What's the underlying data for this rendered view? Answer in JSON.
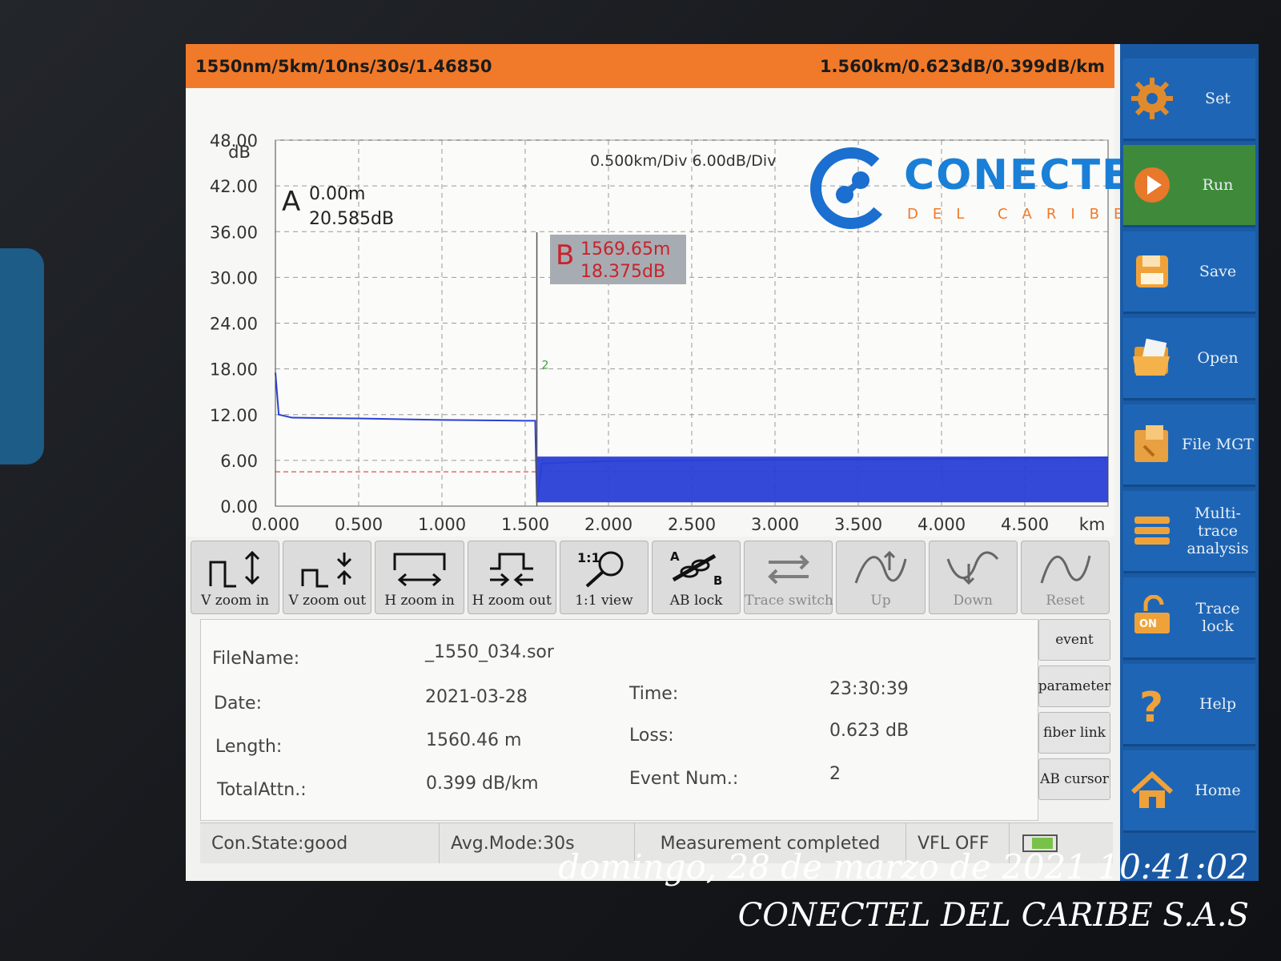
{
  "header": {
    "left": "1550nm/5km/10ns/30s/1.46850",
    "right": "1.560km/0.623dB/0.399dB/km"
  },
  "plot": {
    "scale": "0.500km/Div  6.00dB/Div",
    "y_unit": "dB",
    "x_unit": "km",
    "cursor_a": {
      "letter": "A",
      "distance": "0.00m",
      "level": "20.585dB"
    },
    "cursor_b": {
      "letter": "B",
      "distance": "1569.65m",
      "level": "18.375dB"
    },
    "event_marker": "2"
  },
  "chart_data": {
    "type": "line",
    "xlabel": "km",
    "ylabel": "dB",
    "xlim": [
      0,
      5.0
    ],
    "ylim": [
      0,
      48
    ],
    "x_ticks": [
      "0.000",
      "0.500",
      "1.000",
      "1.500",
      "2.000",
      "2.500",
      "3.000",
      "3.500",
      "4.000",
      "4.500"
    ],
    "y_ticks": [
      "48.00",
      "42.00",
      "36.00",
      "30.00",
      "24.00",
      "18.00",
      "12.00",
      "6.00",
      "0.00"
    ],
    "grid": true,
    "series": [
      {
        "x": [
          0.0,
          0.02,
          0.1,
          0.5,
          1.0,
          1.5,
          1.56,
          1.57,
          1.6,
          2.0,
          3.0,
          4.0,
          5.0
        ],
        "y": [
          17.5,
          12.0,
          11.6,
          11.5,
          11.3,
          11.2,
          11.2,
          0.5,
          5.6,
          5.9,
          6.1,
          6.2,
          6.4
        ]
      }
    ],
    "noise_floor_db": [
      0.5,
      6.5
    ],
    "reference_line_db": 4.5,
    "colors": {
      "trace": "#2a3fd6",
      "reference": "#e05050",
      "grid": "#9a9a9a"
    }
  },
  "logo": {
    "brand": "CONECTEL",
    "sub": "DEL CARIBE"
  },
  "toolbar": [
    {
      "label": "V zoom in",
      "icon": "v-zoom-in-icon",
      "enabled": true
    },
    {
      "label": "V zoom out",
      "icon": "v-zoom-out-icon",
      "enabled": true
    },
    {
      "label": "H zoom in",
      "icon": "h-zoom-in-icon",
      "enabled": true
    },
    {
      "label": "H zoom out",
      "icon": "h-zoom-out-icon",
      "enabled": true
    },
    {
      "label": "1:1 view",
      "icon": "magnifier-icon",
      "enabled": true
    },
    {
      "label": "AB lock",
      "icon": "ab-lock-icon",
      "enabled": true
    },
    {
      "label": "Trace switch",
      "icon": "swap-arrows-icon",
      "enabled": false
    },
    {
      "label": "Up",
      "icon": "wave-up-icon",
      "enabled": false
    },
    {
      "label": "Down",
      "icon": "wave-down-icon",
      "enabled": false
    },
    {
      "label": "Reset",
      "icon": "wave-icon",
      "enabled": false
    }
  ],
  "info": {
    "filename_label": "FileName:",
    "filename": "_1550_034.sor",
    "date_label": "Date:",
    "date": "2021-03-28",
    "time_label": "Time:",
    "time": "23:30:39",
    "length_label": "Length:",
    "length": "1560.46 m",
    "loss_label": "Loss:",
    "loss": "0.623 dB",
    "attn_label": "TotalAttn.:",
    "attn": "0.399 dB/km",
    "events_label": "Event Num.:",
    "events": "2"
  },
  "info_tabs": [
    "event",
    "parameter",
    "fiber link",
    "AB cursor"
  ],
  "status": {
    "connection": "Con.State:good",
    "avg_mode": "Avg.Mode:30s",
    "message": "Measurement completed",
    "vfl": "VFL OFF"
  },
  "sidebar": [
    {
      "label": "Set",
      "icon": "gear-icon"
    },
    {
      "label": "Run",
      "icon": "play-icon"
    },
    {
      "label": "Save",
      "icon": "save-icon"
    },
    {
      "label": "Open",
      "icon": "folder-open-icon"
    },
    {
      "label": "File MGT",
      "icon": "file-manager-icon"
    },
    {
      "label": "Multi-trace analysis",
      "icon": "multi-trace-icon"
    },
    {
      "label": "Trace lock",
      "icon": "lock-toggle-icon"
    },
    {
      "label": "Help",
      "icon": "help-icon"
    },
    {
      "label": "Home",
      "icon": "home-icon"
    }
  ],
  "watermark": {
    "datetime": "domingo, 28 de marzo de 2021 10:41:02",
    "company": "CONECTEL DEL CARIBE S.A.S"
  }
}
